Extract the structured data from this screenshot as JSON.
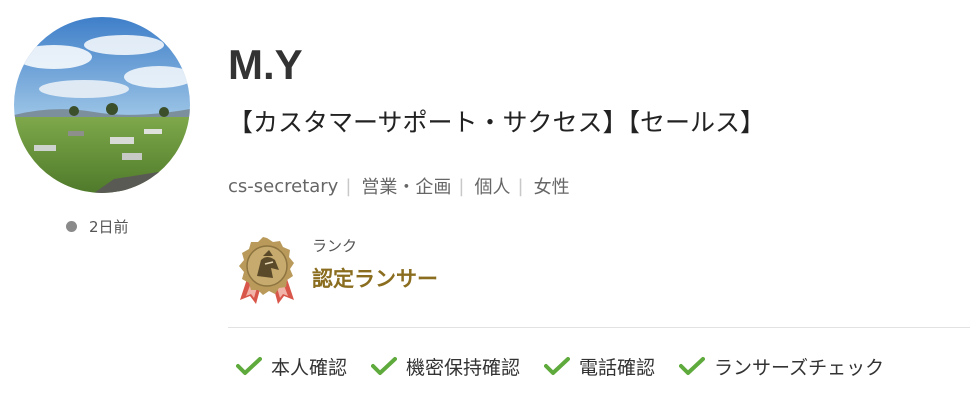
{
  "profile": {
    "name": "M.Y",
    "catchphrase": "【カスタマーサポート・サクセス】【セールス】",
    "last_login": "2日前",
    "meta": [
      "cs-secretary",
      "営業・企画",
      "個人",
      "女性"
    ]
  },
  "rank": {
    "label": "ランク",
    "value": "認定ランサー",
    "color": "#8a6d1f"
  },
  "verifications": [
    {
      "label": "本人確認",
      "icon": "check-icon"
    },
    {
      "label": "機密保持確認",
      "icon": "check-icon"
    },
    {
      "label": "電話確認",
      "icon": "check-icon"
    },
    {
      "label": "ランサーズチェック",
      "icon": "check-icon"
    }
  ],
  "colors": {
    "check": "#5faa3c",
    "online_dot": "#8a8a8a",
    "rank_text": "#8a6d1f"
  }
}
